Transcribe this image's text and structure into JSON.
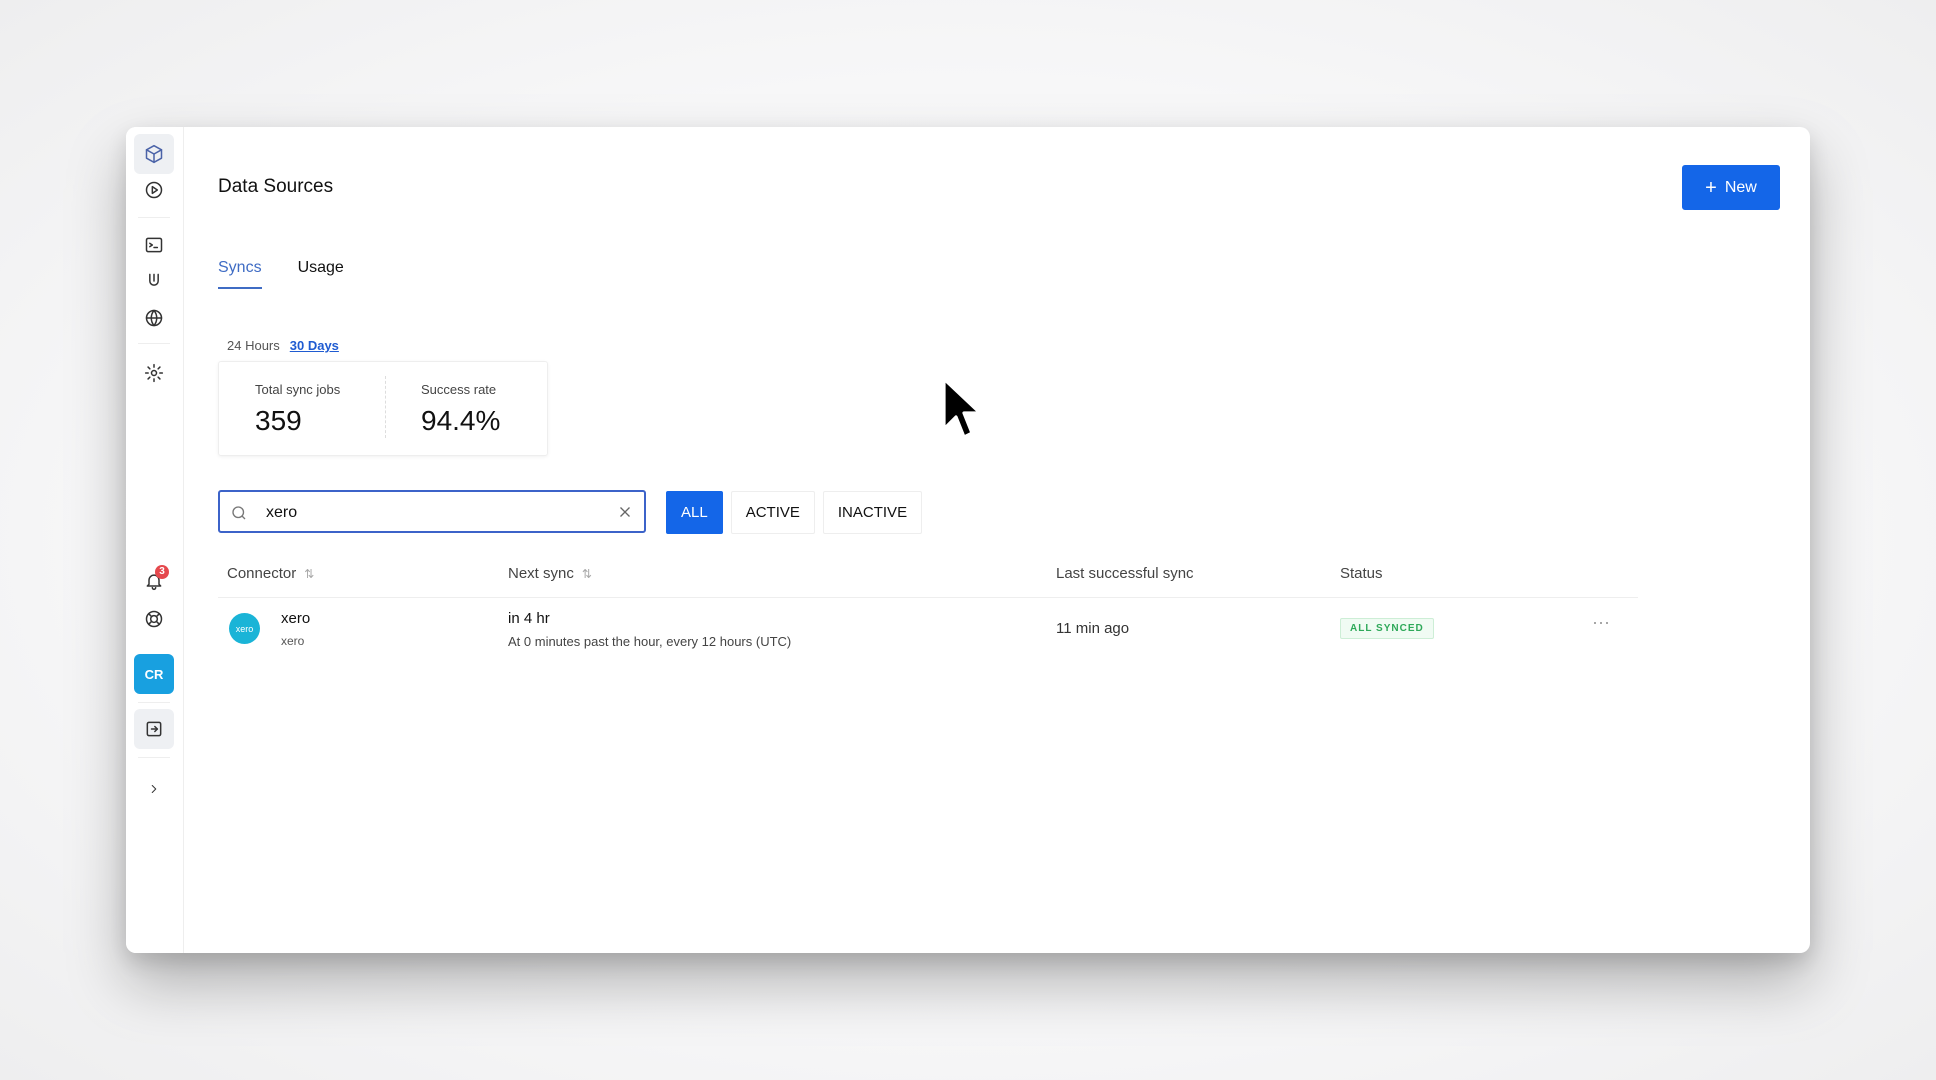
{
  "page": {
    "title": "Data Sources"
  },
  "header": {
    "new_button_label": "New"
  },
  "tabs": [
    {
      "label": "Syncs",
      "active": true
    },
    {
      "label": "Usage",
      "active": false
    }
  ],
  "time_range": [
    {
      "label": "24 Hours",
      "active": false
    },
    {
      "label": "30 Days",
      "active": true
    }
  ],
  "stats": [
    {
      "label": "Total sync jobs",
      "value": "359"
    },
    {
      "label": "Success rate",
      "value": "94.4%"
    }
  ],
  "search": {
    "value": "xero",
    "placeholder": ""
  },
  "filters": [
    {
      "label": "ALL",
      "active": true
    },
    {
      "label": "ACTIVE",
      "active": false
    },
    {
      "label": "INACTIVE",
      "active": false
    }
  ],
  "table": {
    "columns": [
      "Connector",
      "Next sync",
      "Last successful sync",
      "Status"
    ],
    "rows": [
      {
        "logo_text": "xero",
        "connector_name": "xero",
        "connector_sub": "xero",
        "next_sync": "in 4 hr",
        "next_sync_detail": "At 0 minutes past the hour, every 12 hours (UTC)",
        "last_sync": "11 min ago",
        "status": "ALL SYNCED",
        "more": "···"
      }
    ]
  },
  "sidebar": {
    "notification_count": "3",
    "avatar_initials": "CR"
  },
  "colors": {
    "primary": "#1466e8",
    "accent": "#3f6cc4",
    "status_green": "#2fa95a",
    "avatar": "#18a0e0"
  }
}
